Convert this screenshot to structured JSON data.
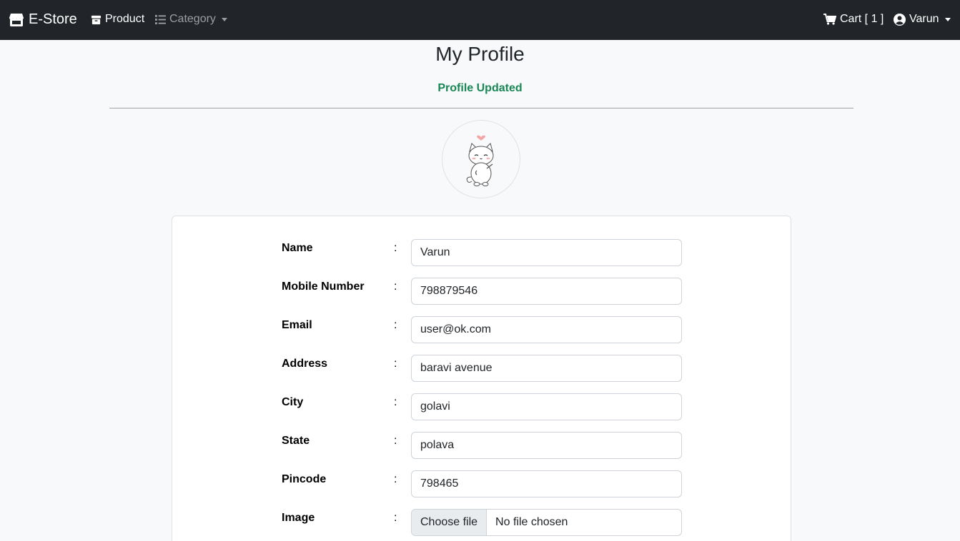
{
  "navbar": {
    "brand": "E-Store",
    "product": "Product",
    "category": "Category",
    "cart": "Cart [ 1 ]",
    "user": "Varun"
  },
  "page": {
    "title": "My Profile",
    "status": "Profile Updated"
  },
  "colors": {
    "navbar_bg": "#212529",
    "status_green": "#198754",
    "page_bg": "#f8f9fa"
  },
  "profile": {
    "colon": ":",
    "fields": [
      {
        "label": "Name",
        "value": "Varun"
      },
      {
        "label": "Mobile Number",
        "value": "798879546"
      },
      {
        "label": "Email",
        "value": "user@ok.com"
      },
      {
        "label": "Address",
        "value": "baravi avenue"
      },
      {
        "label": "City",
        "value": "golavi"
      },
      {
        "label": "State",
        "value": "polava"
      },
      {
        "label": "Pincode",
        "value": "798465"
      }
    ],
    "image": {
      "label": "Image",
      "button": "Choose file",
      "status": "No file chosen"
    }
  }
}
